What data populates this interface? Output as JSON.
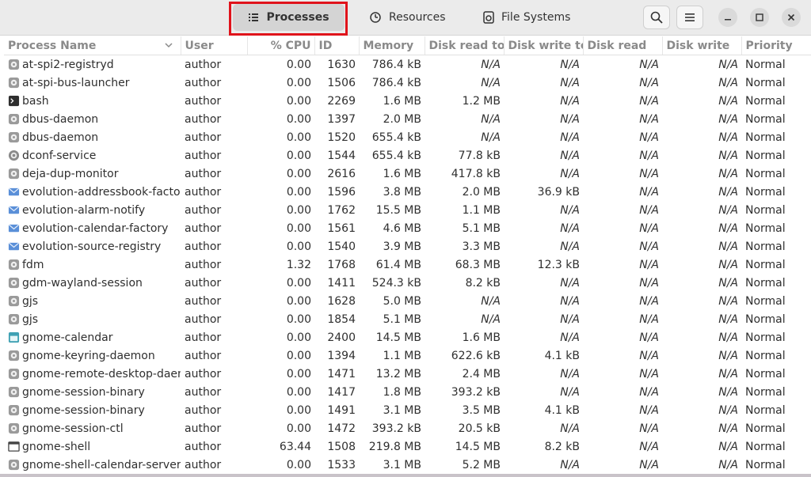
{
  "tabs": [
    {
      "label": "Processes",
      "icon": "list-icon",
      "active": true
    },
    {
      "label": "Resources",
      "icon": "gauge-icon",
      "active": false
    },
    {
      "label": "File Systems",
      "icon": "disk-icon",
      "active": false
    }
  ],
  "columns": [
    "Process Name",
    "User",
    "% CPU",
    "ID",
    "Memory",
    "Disk read tota",
    "Disk write tot",
    "Disk read",
    "Disk write",
    "Priority"
  ],
  "rows": [
    {
      "icon": "gear",
      "name": "at-spi2-registryd",
      "user": "author",
      "cpu": "0.00",
      "id": "1630",
      "mem": "786.4 kB",
      "dr_total": "N/A",
      "dw_total": "N/A",
      "dr": "N/A",
      "dw": "N/A",
      "priority": "Normal"
    },
    {
      "icon": "gear",
      "name": "at-spi-bus-launcher",
      "user": "author",
      "cpu": "0.00",
      "id": "1506",
      "mem": "786.4 kB",
      "dr_total": "N/A",
      "dw_total": "N/A",
      "dr": "N/A",
      "dw": "N/A",
      "priority": "Normal"
    },
    {
      "icon": "terminal",
      "name": "bash",
      "user": "author",
      "cpu": "0.00",
      "id": "2269",
      "mem": "1.6 MB",
      "dr_total": "1.2 MB",
      "dw_total": "N/A",
      "dr": "N/A",
      "dw": "N/A",
      "priority": "Normal"
    },
    {
      "icon": "gear",
      "name": "dbus-daemon",
      "user": "author",
      "cpu": "0.00",
      "id": "1397",
      "mem": "2.0 MB",
      "dr_total": "N/A",
      "dw_total": "N/A",
      "dr": "N/A",
      "dw": "N/A",
      "priority": "Normal"
    },
    {
      "icon": "gear",
      "name": "dbus-daemon",
      "user": "author",
      "cpu": "0.00",
      "id": "1520",
      "mem": "655.4 kB",
      "dr_total": "N/A",
      "dw_total": "N/A",
      "dr": "N/A",
      "dw": "N/A",
      "priority": "Normal"
    },
    {
      "icon": "cog",
      "name": "dconf-service",
      "user": "author",
      "cpu": "0.00",
      "id": "1544",
      "mem": "655.4 kB",
      "dr_total": "77.8 kB",
      "dw_total": "N/A",
      "dr": "N/A",
      "dw": "N/A",
      "priority": "Normal"
    },
    {
      "icon": "gear",
      "name": "deja-dup-monitor",
      "user": "author",
      "cpu": "0.00",
      "id": "2616",
      "mem": "1.6 MB",
      "dr_total": "417.8 kB",
      "dw_total": "N/A",
      "dr": "N/A",
      "dw": "N/A",
      "priority": "Normal"
    },
    {
      "icon": "mail",
      "name": "evolution-addressbook-factory",
      "user": "author",
      "cpu": "0.00",
      "id": "1596",
      "mem": "3.8 MB",
      "dr_total": "2.0 MB",
      "dw_total": "36.9 kB",
      "dr": "N/A",
      "dw": "N/A",
      "priority": "Normal"
    },
    {
      "icon": "mail",
      "name": "evolution-alarm-notify",
      "user": "author",
      "cpu": "0.00",
      "id": "1762",
      "mem": "15.5 MB",
      "dr_total": "1.1 MB",
      "dw_total": "N/A",
      "dr": "N/A",
      "dw": "N/A",
      "priority": "Normal"
    },
    {
      "icon": "mail",
      "name": "evolution-calendar-factory",
      "user": "author",
      "cpu": "0.00",
      "id": "1561",
      "mem": "4.6 MB",
      "dr_total": "5.1 MB",
      "dw_total": "N/A",
      "dr": "N/A",
      "dw": "N/A",
      "priority": "Normal"
    },
    {
      "icon": "mail",
      "name": "evolution-source-registry",
      "user": "author",
      "cpu": "0.00",
      "id": "1540",
      "mem": "3.9 MB",
      "dr_total": "3.3 MB",
      "dw_total": "N/A",
      "dr": "N/A",
      "dw": "N/A",
      "priority": "Normal"
    },
    {
      "icon": "gear",
      "name": "fdm",
      "user": "author",
      "cpu": "1.32",
      "id": "1768",
      "mem": "61.4 MB",
      "dr_total": "68.3 MB",
      "dw_total": "12.3 kB",
      "dr": "N/A",
      "dw": "N/A",
      "priority": "Normal"
    },
    {
      "icon": "gear",
      "name": "gdm-wayland-session",
      "user": "author",
      "cpu": "0.00",
      "id": "1411",
      "mem": "524.3 kB",
      "dr_total": "8.2 kB",
      "dw_total": "N/A",
      "dr": "N/A",
      "dw": "N/A",
      "priority": "Normal"
    },
    {
      "icon": "gear",
      "name": "gjs",
      "user": "author",
      "cpu": "0.00",
      "id": "1628",
      "mem": "5.0 MB",
      "dr_total": "N/A",
      "dw_total": "N/A",
      "dr": "N/A",
      "dw": "N/A",
      "priority": "Normal"
    },
    {
      "icon": "gear",
      "name": "gjs",
      "user": "author",
      "cpu": "0.00",
      "id": "1854",
      "mem": "5.1 MB",
      "dr_total": "N/A",
      "dw_total": "N/A",
      "dr": "N/A",
      "dw": "N/A",
      "priority": "Normal"
    },
    {
      "icon": "calendar",
      "name": "gnome-calendar",
      "user": "author",
      "cpu": "0.00",
      "id": "2400",
      "mem": "14.5 MB",
      "dr_total": "1.6 MB",
      "dw_total": "N/A",
      "dr": "N/A",
      "dw": "N/A",
      "priority": "Normal"
    },
    {
      "icon": "gear",
      "name": "gnome-keyring-daemon",
      "user": "author",
      "cpu": "0.00",
      "id": "1394",
      "mem": "1.1 MB",
      "dr_total": "622.6 kB",
      "dw_total": "4.1 kB",
      "dr": "N/A",
      "dw": "N/A",
      "priority": "Normal"
    },
    {
      "icon": "gear",
      "name": "gnome-remote-desktop-daem",
      "user": "author",
      "cpu": "0.00",
      "id": "1471",
      "mem": "13.2 MB",
      "dr_total": "2.4 MB",
      "dw_total": "N/A",
      "dr": "N/A",
      "dw": "N/A",
      "priority": "Normal"
    },
    {
      "icon": "gear",
      "name": "gnome-session-binary",
      "user": "author",
      "cpu": "0.00",
      "id": "1417",
      "mem": "1.8 MB",
      "dr_total": "393.2 kB",
      "dw_total": "N/A",
      "dr": "N/A",
      "dw": "N/A",
      "priority": "Normal"
    },
    {
      "icon": "gear",
      "name": "gnome-session-binary",
      "user": "author",
      "cpu": "0.00",
      "id": "1491",
      "mem": "3.1 MB",
      "dr_total": "3.5 MB",
      "dw_total": "4.1 kB",
      "dr": "N/A",
      "dw": "N/A",
      "priority": "Normal"
    },
    {
      "icon": "gear",
      "name": "gnome-session-ctl",
      "user": "author",
      "cpu": "0.00",
      "id": "1472",
      "mem": "393.2 kB",
      "dr_total": "20.5 kB",
      "dw_total": "N/A",
      "dr": "N/A",
      "dw": "N/A",
      "priority": "Normal"
    },
    {
      "icon": "window",
      "name": "gnome-shell",
      "user": "author",
      "cpu": "63.44",
      "id": "1508",
      "mem": "219.8 MB",
      "dr_total": "14.5 MB",
      "dw_total": "8.2 kB",
      "dr": "N/A",
      "dw": "N/A",
      "priority": "Normal"
    },
    {
      "icon": "gear",
      "name": "gnome-shell-calendar-server",
      "user": "author",
      "cpu": "0.00",
      "id": "1533",
      "mem": "3.1 MB",
      "dr_total": "5.2 MB",
      "dw_total": "N/A",
      "dr": "N/A",
      "dw": "N/A",
      "priority": "Normal"
    }
  ],
  "colors": {
    "highlight": "#e0131b",
    "header_bg": "#ebebeb"
  }
}
